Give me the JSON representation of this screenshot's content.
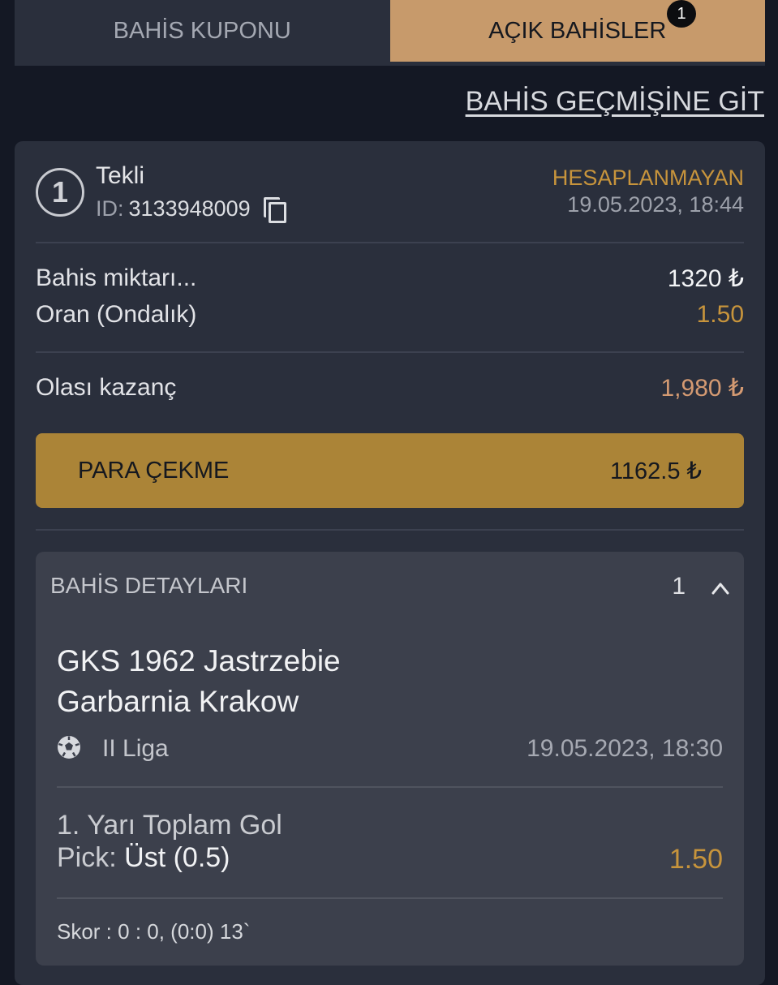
{
  "tabs": {
    "coupon_label": "BAHİS KUPONU",
    "open_bets_label": "AÇIK BAHİSLER",
    "open_bets_count": "1"
  },
  "history_link": "BAHİS GEÇMİŞİNE GİT",
  "bet": {
    "number": "1",
    "type": "Tekli",
    "id_label": "ID:",
    "id_value": "3133948009",
    "status": "HESAPLANMAYAN",
    "datetime": "19.05.2023, 18:44",
    "stake_label": "Bahis miktarı...",
    "stake_value": "1320 ₺",
    "odds_label": "Oran (Ondalık)",
    "odds_value": "1.50",
    "potential_label": "Olası kazanç",
    "potential_value": "1,980 ₺",
    "cashout_label": "PARA ÇEKME",
    "cashout_value": "1162.5 ₺"
  },
  "details": {
    "title": "BAHİS DETAYLARI",
    "count": "1",
    "home_team": "GKS 1962 Jastrzebie",
    "away_team": "Garbarnia Krakow",
    "league": "II Liga",
    "event_datetime": "19.05.2023, 18:30",
    "market": "1. Yarı Toplam Gol",
    "pick_label": "Pick:",
    "pick_value": "Üst (0.5)",
    "pick_odds": "1.50",
    "score": "Skor : 0 : 0, (0:0) 13`"
  },
  "colors": {
    "background": "#141824",
    "card": "#2a2f3c",
    "accent_tab": "#c79a6b",
    "status_gold": "#c7943c",
    "cashout": "#ab8437",
    "potential_win": "#d49a72"
  },
  "icons": [
    "copy-icon",
    "chevron-up-icon",
    "soccer-ball-icon"
  ]
}
